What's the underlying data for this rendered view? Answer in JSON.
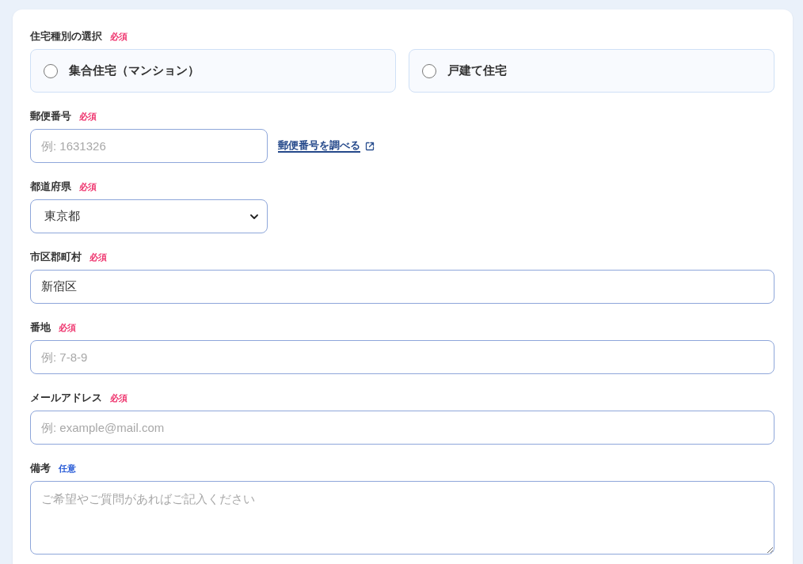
{
  "form": {
    "fields": [
      {
        "kind": "radio",
        "label": "住宅種別の選択",
        "badge": {
          "kind": "required",
          "text": "必須"
        },
        "options": [
          {
            "label": "集合住宅（マンション）",
            "selected": false
          },
          {
            "label": "戸建て住宅",
            "selected": false
          }
        ]
      },
      {
        "kind": "text",
        "label": "郵便番号",
        "badge": {
          "kind": "required",
          "text": "必須"
        },
        "placeholder": "例: 1631326",
        "link": {
          "text": "郵便番号を調べる"
        }
      },
      {
        "kind": "select",
        "label": "都道府県",
        "badge": {
          "kind": "required",
          "text": "必須"
        },
        "value": "東京都"
      },
      {
        "kind": "text",
        "label": "市区郡町村",
        "badge": {
          "kind": "required",
          "text": "必須"
        },
        "value": "新宿区"
      },
      {
        "kind": "text",
        "label": "番地",
        "badge": {
          "kind": "required",
          "text": "必須"
        },
        "placeholder": "例: 7-8-9"
      },
      {
        "kind": "text",
        "label": "メールアドレス",
        "badge": {
          "kind": "required",
          "text": "必須"
        },
        "placeholder": "例: example@mail.com"
      },
      {
        "kind": "textarea",
        "label": "備考",
        "badge": {
          "kind": "optional",
          "text": "任意"
        },
        "placeholder": "ご希望やご質問があればご記入ください"
      }
    ]
  }
}
